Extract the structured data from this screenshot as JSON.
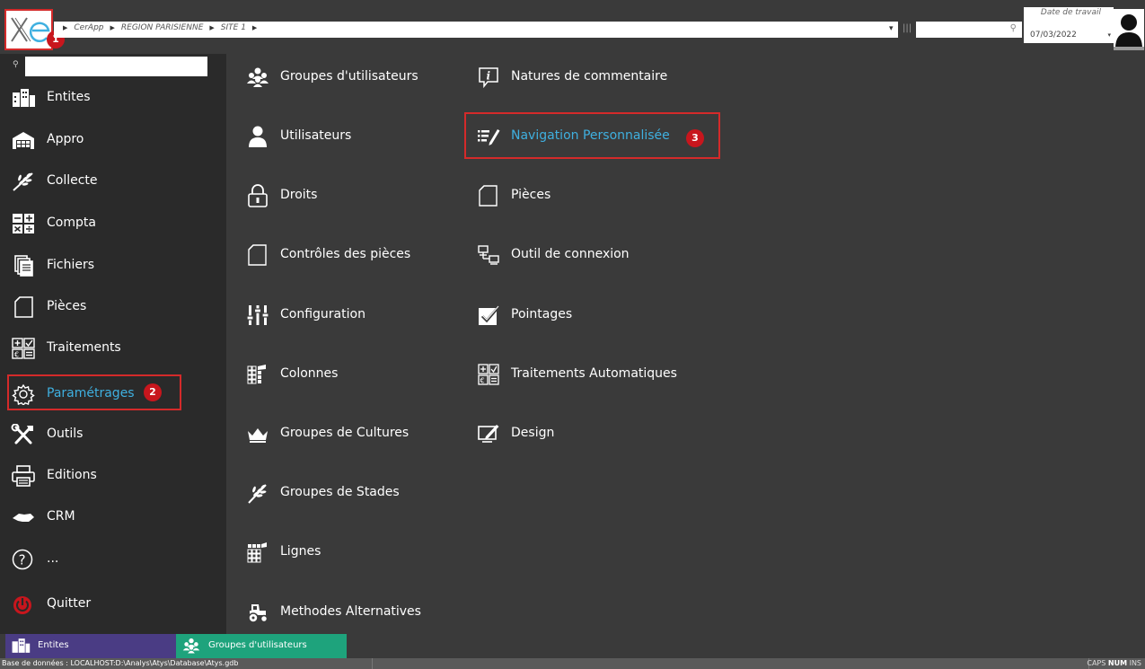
{
  "header": {
    "breadcrumb": [
      "CerApp",
      "REGION PARISIENNE",
      "SITE 1"
    ],
    "date_label": "Date de travail",
    "date_value": "07/03/2022"
  },
  "annotations": {
    "badge1": "1",
    "badge2": "2",
    "badge3": "3"
  },
  "sidebar": {
    "items": [
      {
        "label": "Entites",
        "icon": "buildings-icon"
      },
      {
        "label": "Appro",
        "icon": "warehouse-icon"
      },
      {
        "label": "Collecte",
        "icon": "wheat-icon"
      },
      {
        "label": "Compta",
        "icon": "calculator-icon"
      },
      {
        "label": "Fichiers",
        "icon": "files-icon"
      },
      {
        "label": "Pièces",
        "icon": "document-icon"
      },
      {
        "label": "Traitements",
        "icon": "operations-icon"
      },
      {
        "label": "Paramétrages",
        "icon": "gear-icon",
        "active": true
      },
      {
        "label": "Outils",
        "icon": "tools-icon"
      },
      {
        "label": "Editions",
        "icon": "printer-icon"
      },
      {
        "label": "CRM",
        "icon": "handshake-icon"
      },
      {
        "label": "...",
        "icon": "help-icon"
      },
      {
        "label": "Quitter",
        "icon": "power-icon"
      }
    ]
  },
  "main": {
    "col1": [
      {
        "label": "Groupes d'utilisateurs",
        "icon": "users-group-icon"
      },
      {
        "label": "Utilisateurs",
        "icon": "user-icon"
      },
      {
        "label": "Droits",
        "icon": "lock-icon"
      },
      {
        "label": "Contrôles des pièces",
        "icon": "document-icon"
      },
      {
        "label": "Configuration",
        "icon": "sliders-icon"
      },
      {
        "label": "Colonnes",
        "icon": "columns-icon"
      },
      {
        "label": "Groupes de Cultures",
        "icon": "crown-icon"
      },
      {
        "label": "Groupes de Stades",
        "icon": "wheat-icon"
      },
      {
        "label": "Lignes",
        "icon": "rows-icon"
      },
      {
        "label": "Methodes Alternatives",
        "icon": "tractor-icon"
      }
    ],
    "col2": [
      {
        "label": "Natures de commentaire",
        "icon": "info-comment-icon"
      },
      {
        "label": "Navigation Personnalisée",
        "icon": "edit-list-icon",
        "active": true
      },
      {
        "label": "Pièces",
        "icon": "document-icon"
      },
      {
        "label": "Outil de connexion",
        "icon": "network-icon"
      },
      {
        "label": "Pointages",
        "icon": "checkbox-icon"
      },
      {
        "label": "Traitements Automatiques",
        "icon": "operations-icon"
      },
      {
        "label": "Design",
        "icon": "design-icon"
      }
    ]
  },
  "taskbar": {
    "tabs": [
      {
        "label": "Entites",
        "icon": "buildings-icon"
      },
      {
        "label": "Groupes d'utilisateurs",
        "icon": "users-group-icon"
      }
    ]
  },
  "status": {
    "database": "Base de données : LOCALHOST:D:\\Analys\\Atys\\Database\\Atys.gdb",
    "caps": "CAPS",
    "num": "NUM",
    "ins": "INS"
  },
  "colors": {
    "accent_blue": "#3fb0e0",
    "highlight_red": "#d42a2a",
    "badge_red": "#c8161d",
    "tab_purple": "#4a3c84",
    "tab_green": "#1ea37c"
  }
}
